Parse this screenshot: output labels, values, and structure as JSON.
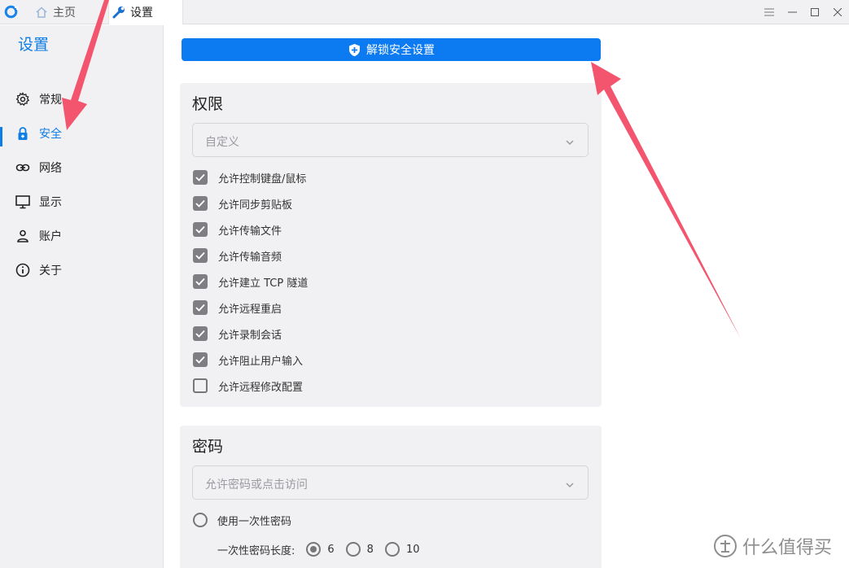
{
  "titlebar": {
    "tabs": [
      {
        "label": "主页",
        "icon": "home-icon"
      },
      {
        "label": "设置",
        "icon": "wrench-icon"
      }
    ],
    "controls": [
      "menu-icon",
      "minimize-icon",
      "maximize-icon",
      "close-icon"
    ]
  },
  "sidebar": {
    "title": "设置",
    "items": [
      {
        "label": "常规",
        "icon": "gear-icon"
      },
      {
        "label": "安全",
        "icon": "lock-icon",
        "active": true
      },
      {
        "label": "网络",
        "icon": "link-icon"
      },
      {
        "label": "显示",
        "icon": "monitor-icon"
      },
      {
        "label": "账户",
        "icon": "user-icon"
      },
      {
        "label": "关于",
        "icon": "info-icon"
      }
    ]
  },
  "main": {
    "unlock_button": "解锁安全设置",
    "permissions": {
      "title": "权限",
      "preset": "自定义",
      "options": [
        {
          "label": "允许控制键盘/鼠标",
          "checked": true
        },
        {
          "label": "允许同步剪贴板",
          "checked": true
        },
        {
          "label": "允许传输文件",
          "checked": true
        },
        {
          "label": "允许传输音频",
          "checked": true
        },
        {
          "label": "允许建立 TCP 隧道",
          "checked": true
        },
        {
          "label": "允许远程重启",
          "checked": true
        },
        {
          "label": "允许录制会话",
          "checked": true
        },
        {
          "label": "允许阻止用户输入",
          "checked": true
        },
        {
          "label": "允许远程修改配置",
          "checked": false
        }
      ]
    },
    "password": {
      "title": "密码",
      "mode": "允许密码或点击访问",
      "one_time_label": "使用一次性密码",
      "length_label": "一次性密码长度:",
      "lengths": [
        "6",
        "8",
        "10"
      ],
      "selected_length": "6"
    }
  },
  "colors": {
    "accent": "#0e7de6",
    "button": "#0c7af0",
    "annotation_arrow": "#f2556d",
    "panel": "#f1f1f3"
  },
  "watermark": "什么值得买"
}
